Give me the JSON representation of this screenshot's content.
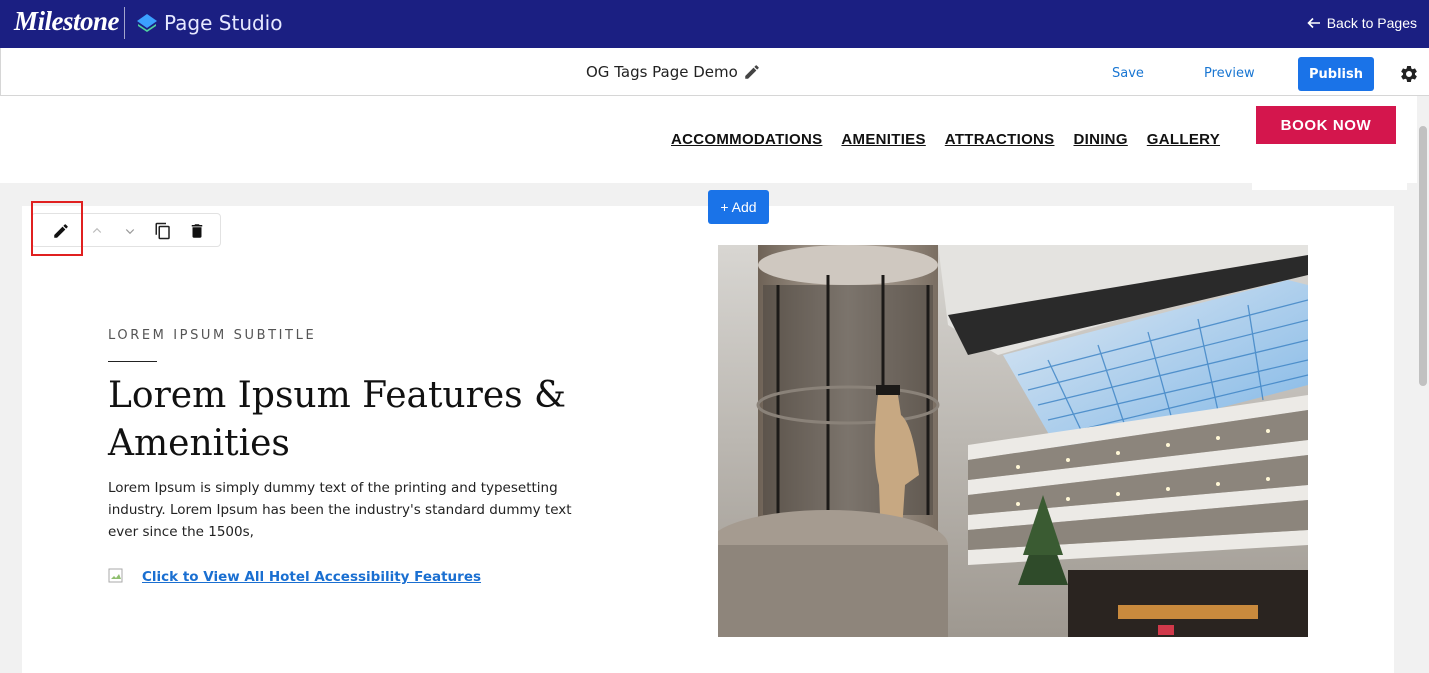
{
  "topbar": {
    "brand": "Milestone",
    "product": "Page Studio",
    "back_label": "Back to Pages"
  },
  "editbar": {
    "page_name": "OG Tags Page Demo",
    "save_label": "Save",
    "preview_label": "Preview",
    "publish_label": "Publish"
  },
  "site": {
    "nav": [
      "ACCOMMODATIONS",
      "AMENITIES",
      "ATTRACTIONS",
      "DINING",
      "GALLERY"
    ],
    "book_label": "BOOK NOW"
  },
  "add_label": "+ Add",
  "section": {
    "subtitle": "LOREM IPSUM SUBTITLE",
    "heading": "Lorem Ipsum Features & Amenities",
    "body": "Lorem Ipsum is simply dummy text of the printing and typesetting industry. Lorem Ipsum has been the industry's standard dummy text ever since the 1500s,",
    "link_label": "Click to View All Hotel Accessibility Features"
  },
  "colors": {
    "topbar_bg": "#1b1f82",
    "accent_blue": "#1a73e8",
    "book_red": "#d4164d",
    "highlight_red": "#e02020"
  }
}
